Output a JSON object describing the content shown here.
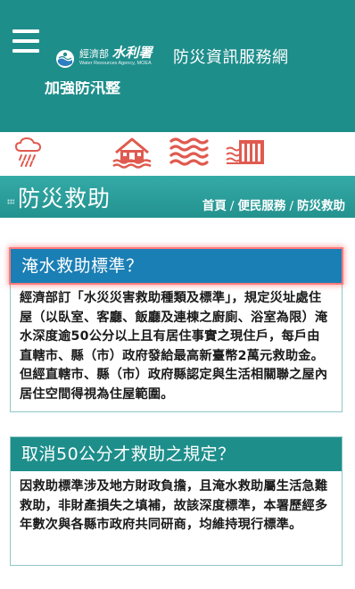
{
  "header": {
    "menu_icon": "hamburger-menu-icon",
    "logo": {
      "emblem_icon": "water-resources-agency-emblem-icon",
      "ministry": "經濟部",
      "agency": "水利署",
      "english": "Water Resources Agency, MOEA"
    },
    "site_title": "防災資訊服務網",
    "marquee_text": "加強防汛整"
  },
  "category_icons": [
    {
      "name": "rain-cloud-icon",
      "color": "#e05a4f"
    },
    {
      "name": "flooded-house-icon",
      "color": "#e05a4f"
    },
    {
      "name": "waves-icon",
      "color": "#e05a4f"
    },
    {
      "name": "dam-floodgate-icon",
      "color": "#e05a4f"
    }
  ],
  "page": {
    "title": "防災救助",
    "breadcrumb": [
      "首頁",
      "便民服務",
      "防災救助"
    ]
  },
  "faqs": [
    {
      "question": "淹水救助標準？",
      "answer": "經濟部訂「水災災害救助種類及標準」，規定災址處住屋（以臥室、客廳、飯廳及連棟之廚廁、浴室為限）淹水深度逾50公分以上且有居住事實之現住戶，每戶由直轄市、縣（市）政府發給最高新臺幣2萬元救助金。但經直轄市、縣（市）政府縣認定與生活相關聯之屋內居住空間得視為住屋範圍。"
    },
    {
      "question": "取消50公分才救助之規定？",
      "answer": "因救助標準涉及地方財政負擔，且淹水救助屬生活急難救助，非財產損失之填補，故該深度標準，本署歷經多年數次與各縣市政府共同研商，均維持現行標準。"
    }
  ],
  "colors": {
    "header_bg": "#1e8e8b",
    "titlebar_bg": "#2aa19d",
    "icon_accent": "#e05a4f",
    "highlight_head": "#1a7fb5",
    "highlight_glow": "#ff7a7a"
  }
}
